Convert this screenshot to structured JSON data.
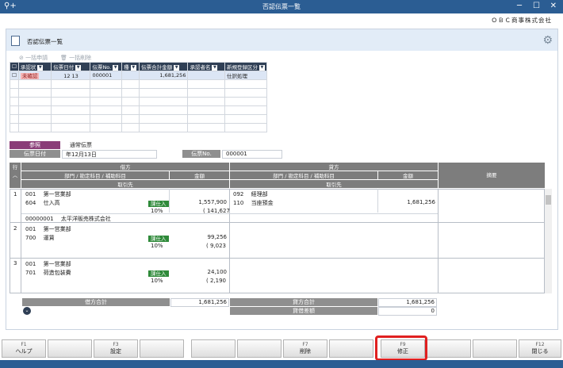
{
  "window": {
    "title": "否認伝票一覧",
    "company": "ＯＢＣ商事株式会社",
    "app_icon": "key-plus-icon"
  },
  "panel": {
    "title": "否認伝票一覧"
  },
  "bulk": {
    "apply": "一括申請",
    "delete": "一括削除"
  },
  "list": {
    "headers": [
      "",
      "承認状",
      "伝票日付",
      "伝票No.",
      "種",
      "伝票合計金額",
      "承認者名",
      "新規登録区分"
    ],
    "rows": [
      {
        "status": "未確認",
        "date_mm": "12",
        "date_dd": "13",
        "no": "000001",
        "type": "",
        "amount": "1,681,256",
        "approver": "",
        "reg": "仕訳処理"
      }
    ]
  },
  "detail": {
    "ref_label": "参照",
    "ref_value": "通常伝票",
    "date_label": "伝票日付",
    "date_value": "年12月13日",
    "no_label": "伝票No.",
    "no_value": "000001"
  },
  "journal": {
    "row_header": "行",
    "debit": "借方",
    "credit": "貸方",
    "dept_label": "部門 / 勘定科目 / 補助科目",
    "amount_label": "金額",
    "partner_label": "取引先",
    "memo_label": "摘要",
    "rows": [
      {
        "num": "1",
        "d_dept_code": "001",
        "d_dept": "第一営業部",
        "d_acct_code": "604",
        "d_acct": "仕入高",
        "d_tax": "課仕入",
        "d_amount": "1,557,900",
        "d_rate": "10%",
        "d_taxamt": "( 141,627",
        "c_dept_code": "092",
        "c_dept": "経理部",
        "c_acct_code": "110",
        "c_acct": "当座預金",
        "c_amount": "1,681,256",
        "partner_code": "00000001",
        "partner": "太平洋販売株式会社"
      },
      {
        "num": "2",
        "d_dept_code": "001",
        "d_dept": "第一営業部",
        "d_acct_code": "700",
        "d_acct": "運賃",
        "d_tax": "課仕入",
        "d_amount": "99,256",
        "d_rate": "10%",
        "d_taxamt": "( 9,023"
      },
      {
        "num": "3",
        "d_dept_code": "001",
        "d_dept": "第一営業部",
        "d_acct_code": "701",
        "d_acct": "荷造包装費",
        "d_tax": "課仕入",
        "d_amount": "24,100",
        "d_rate": "10%",
        "d_taxamt": "( 2,190"
      }
    ],
    "debit_total_label": "借方合計",
    "debit_total": "1,681,256",
    "credit_total_label": "貸方合計",
    "credit_total": "1,681,256",
    "diff_label": "貸借差額",
    "diff": "0"
  },
  "fkeys": [
    {
      "key": "F1",
      "label": "ヘルプ"
    },
    {
      "key": "",
      "label": ""
    },
    {
      "key": "F3",
      "label": "設定"
    },
    {
      "key": "",
      "label": ""
    },
    {
      "key": "",
      "label": ""
    },
    {
      "key": "",
      "label": ""
    },
    {
      "key": "F7",
      "label": "削除"
    },
    {
      "key": "",
      "label": ""
    },
    {
      "key": "F9",
      "label": "修正"
    },
    {
      "key": "",
      "label": ""
    },
    {
      "key": "",
      "label": ""
    },
    {
      "key": "F12",
      "label": "閉じる"
    }
  ],
  "highlight_color": "#e02020"
}
